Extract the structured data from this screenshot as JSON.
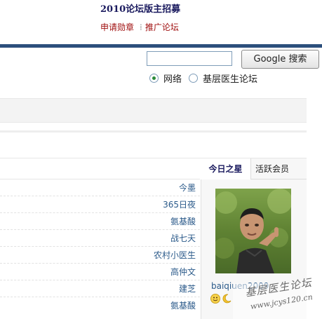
{
  "header": {
    "title": "2010论坛版主招募",
    "links": [
      "申请勋章",
      "推广论坛"
    ]
  },
  "search": {
    "input_value": "",
    "button_label": "Google 搜索",
    "options": [
      {
        "label": "网络",
        "checked": true
      },
      {
        "label": "基层医生论坛",
        "checked": false
      }
    ]
  },
  "side_panel": {
    "tabs": [
      "今日之星",
      "活跃会员"
    ],
    "active_tab": "今日之星",
    "star_user": "baiqiuen2009",
    "status_icons": [
      "smiley-face-icon",
      "crescent-moon-icon"
    ]
  },
  "list": {
    "names": [
      "今墨",
      "365日夜",
      "氨基酸",
      "战七天",
      "农村小医生",
      "高仲文",
      "建芝",
      "氨基酸"
    ]
  },
  "watermark": {
    "text": "基层医生论坛",
    "url": "www.jcys120.cn"
  },
  "colors": {
    "accent_bar": "#2c4f7c",
    "link_red": "#a01010",
    "link_blue": "#2b5a8a",
    "title_navy": "#1a1a5e"
  }
}
